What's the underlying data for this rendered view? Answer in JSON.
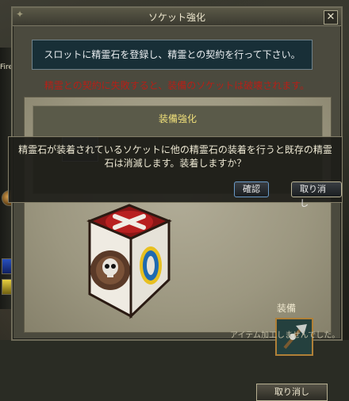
{
  "window": {
    "title": "ソケット強化",
    "close_label": "✕"
  },
  "info": {
    "text": "スロットに精霊石を登録し、精霊との契約を行って下さい。"
  },
  "warning": {
    "text": "精霊との契約に失敗すると、装備のソケットは破壊されます。"
  },
  "enhance": {
    "title": "装備強化"
  },
  "equip": {
    "label": "装備",
    "cancel_label": "取り消し"
  },
  "modal": {
    "text": "精霊石が装着されているソケットに他の精霊石の装着を行うと既存の精霊石は消滅します。装着しますか？",
    "ok_label": "確認",
    "cancel_label": "取り消し"
  },
  "side": {
    "fire_text": "Fire"
  },
  "footer": {
    "text": "アイテム加工しませんでした。"
  },
  "colors": {
    "warning": "#b61f17",
    "title": "#f0e07a"
  }
}
